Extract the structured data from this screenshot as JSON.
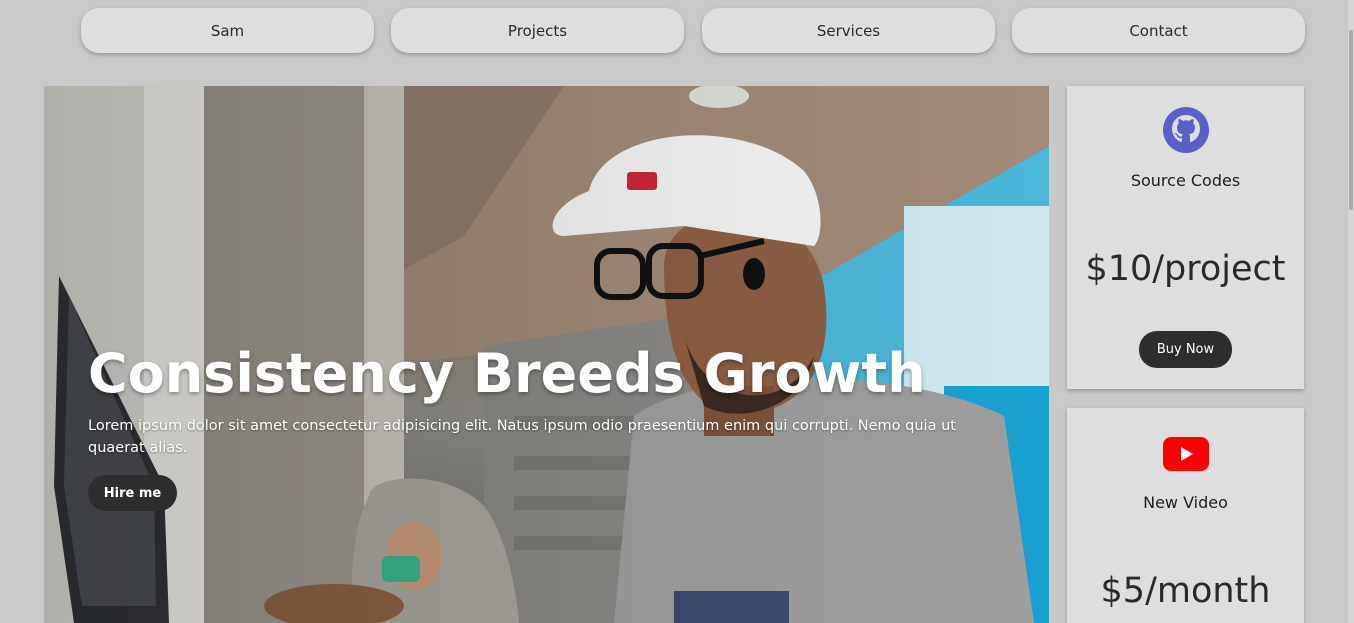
{
  "nav": {
    "items": [
      {
        "label": "Sam"
      },
      {
        "label": "Projects"
      },
      {
        "label": "Services"
      },
      {
        "label": "Contact"
      }
    ]
  },
  "hero": {
    "title": "Consistency Breeds Growth",
    "text": "Lorem ipsum dolor sit amet consectetur adipisicing elit. Natus ipsum odio praesentium enim qui corrupti. Nemo quia ut quaerat alias.",
    "button_label": "Hire me"
  },
  "cards": [
    {
      "icon": "github-icon",
      "title": "Source Codes",
      "price": "$10/project",
      "button_label": "Buy Now",
      "icon_color": "#5b5fc7"
    },
    {
      "icon": "youtube-icon",
      "title": "New Video",
      "price": "$5/month",
      "icon_color": "#ff0000"
    }
  ],
  "colors": {
    "background": "#c9c9c9",
    "card": "#dedede",
    "button": "#2d2d2d"
  }
}
